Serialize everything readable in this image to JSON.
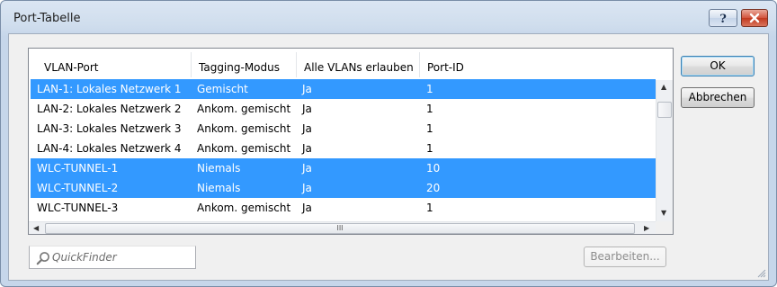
{
  "window": {
    "title": "Port-Tabelle",
    "help_label": "?",
    "close_label": "×"
  },
  "table": {
    "columns": [
      "VLAN-Port",
      "Tagging-Modus",
      "Alle VLANs erlauben",
      "Port-ID"
    ],
    "rows": [
      {
        "port": "LAN-1: Lokales Netzwerk 1",
        "tagging": "Gemischt",
        "all_vlans": "Ja",
        "port_id": "1",
        "selected": true
      },
      {
        "port": "LAN-2: Lokales Netzwerk 2",
        "tagging": "Ankom. gemischt",
        "all_vlans": "Ja",
        "port_id": "1",
        "selected": false
      },
      {
        "port": "LAN-3: Lokales Netzwerk 3",
        "tagging": "Ankom. gemischt",
        "all_vlans": "Ja",
        "port_id": "1",
        "selected": false
      },
      {
        "port": "LAN-4: Lokales Netzwerk 4",
        "tagging": "Ankom. gemischt",
        "all_vlans": "Ja",
        "port_id": "1",
        "selected": false
      },
      {
        "port": "WLC-TUNNEL-1",
        "tagging": "Niemals",
        "all_vlans": "Ja",
        "port_id": "10",
        "selected": true
      },
      {
        "port": "WLC-TUNNEL-2",
        "tagging": "Niemals",
        "all_vlans": "Ja",
        "port_id": "20",
        "selected": true
      },
      {
        "port": "WLC-TUNNEL-3",
        "tagging": "Ankom. gemischt",
        "all_vlans": "Ja",
        "port_id": "1",
        "selected": false
      }
    ],
    "hscroll_grip": "III"
  },
  "buttons": {
    "ok": "OK",
    "cancel": "Abbrechen",
    "edit": "Bearbeiten..."
  },
  "search": {
    "placeholder": "QuickFinder"
  },
  "colors": {
    "selection": "#3399ff",
    "close_button": "#c1391f",
    "frame": "#c6d6ea"
  }
}
